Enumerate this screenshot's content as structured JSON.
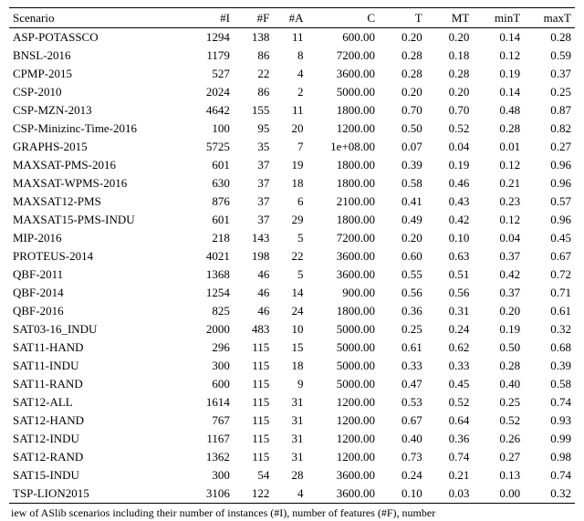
{
  "table": {
    "columns": [
      "Scenario",
      "#I",
      "#F",
      "#A",
      "C",
      "T",
      "MT",
      "minT",
      "maxT"
    ],
    "rows": [
      {
        "scenario": "ASP-POTASSCO",
        "I": "1294",
        "F": "138",
        "A": "11",
        "C": "600.00",
        "T": "0.20",
        "MT": "0.20",
        "minT": "0.14",
        "maxT": "0.28"
      },
      {
        "scenario": "BNSL-2016",
        "I": "1179",
        "F": "86",
        "A": "8",
        "C": "7200.00",
        "T": "0.28",
        "MT": "0.18",
        "minT": "0.12",
        "maxT": "0.59"
      },
      {
        "scenario": "CPMP-2015",
        "I": "527",
        "F": "22",
        "A": "4",
        "C": "3600.00",
        "T": "0.28",
        "MT": "0.28",
        "minT": "0.19",
        "maxT": "0.37"
      },
      {
        "scenario": "CSP-2010",
        "I": "2024",
        "F": "86",
        "A": "2",
        "C": "5000.00",
        "T": "0.20",
        "MT": "0.20",
        "minT": "0.14",
        "maxT": "0.25"
      },
      {
        "scenario": "CSP-MZN-2013",
        "I": "4642",
        "F": "155",
        "A": "11",
        "C": "1800.00",
        "T": "0.70",
        "MT": "0.70",
        "minT": "0.48",
        "maxT": "0.87"
      },
      {
        "scenario": "CSP-Minizinc-Time-2016",
        "I": "100",
        "F": "95",
        "A": "20",
        "C": "1200.00",
        "T": "0.50",
        "MT": "0.52",
        "minT": "0.28",
        "maxT": "0.82"
      },
      {
        "scenario": "GRAPHS-2015",
        "I": "5725",
        "F": "35",
        "A": "7",
        "C": "1e+08.00",
        "T": "0.07",
        "MT": "0.04",
        "minT": "0.01",
        "maxT": "0.27"
      },
      {
        "scenario": "MAXSAT-PMS-2016",
        "I": "601",
        "F": "37",
        "A": "19",
        "C": "1800.00",
        "T": "0.39",
        "MT": "0.19",
        "minT": "0.12",
        "maxT": "0.96"
      },
      {
        "scenario": "MAXSAT-WPMS-2016",
        "I": "630",
        "F": "37",
        "A": "18",
        "C": "1800.00",
        "T": "0.58",
        "MT": "0.46",
        "minT": "0.21",
        "maxT": "0.96"
      },
      {
        "scenario": "MAXSAT12-PMS",
        "I": "876",
        "F": "37",
        "A": "6",
        "C": "2100.00",
        "T": "0.41",
        "MT": "0.43",
        "minT": "0.23",
        "maxT": "0.57"
      },
      {
        "scenario": "MAXSAT15-PMS-INDU",
        "I": "601",
        "F": "37",
        "A": "29",
        "C": "1800.00",
        "T": "0.49",
        "MT": "0.42",
        "minT": "0.12",
        "maxT": "0.96"
      },
      {
        "scenario": "MIP-2016",
        "I": "218",
        "F": "143",
        "A": "5",
        "C": "7200.00",
        "T": "0.20",
        "MT": "0.10",
        "minT": "0.04",
        "maxT": "0.45"
      },
      {
        "scenario": "PROTEUS-2014",
        "I": "4021",
        "F": "198",
        "A": "22",
        "C": "3600.00",
        "T": "0.60",
        "MT": "0.63",
        "minT": "0.37",
        "maxT": "0.67"
      },
      {
        "scenario": "QBF-2011",
        "I": "1368",
        "F": "46",
        "A": "5",
        "C": "3600.00",
        "T": "0.55",
        "MT": "0.51",
        "minT": "0.42",
        "maxT": "0.72"
      },
      {
        "scenario": "QBF-2014",
        "I": "1254",
        "F": "46",
        "A": "14",
        "C": "900.00",
        "T": "0.56",
        "MT": "0.56",
        "minT": "0.37",
        "maxT": "0.71"
      },
      {
        "scenario": "QBF-2016",
        "I": "825",
        "F": "46",
        "A": "24",
        "C": "1800.00",
        "T": "0.36",
        "MT": "0.31",
        "minT": "0.20",
        "maxT": "0.61"
      },
      {
        "scenario": "SAT03-16_INDU",
        "I": "2000",
        "F": "483",
        "A": "10",
        "C": "5000.00",
        "T": "0.25",
        "MT": "0.24",
        "minT": "0.19",
        "maxT": "0.32"
      },
      {
        "scenario": "SAT11-HAND",
        "I": "296",
        "F": "115",
        "A": "15",
        "C": "5000.00",
        "T": "0.61",
        "MT": "0.62",
        "minT": "0.50",
        "maxT": "0.68"
      },
      {
        "scenario": "SAT11-INDU",
        "I": "300",
        "F": "115",
        "A": "18",
        "C": "5000.00",
        "T": "0.33",
        "MT": "0.33",
        "minT": "0.28",
        "maxT": "0.39"
      },
      {
        "scenario": "SAT11-RAND",
        "I": "600",
        "F": "115",
        "A": "9",
        "C": "5000.00",
        "T": "0.47",
        "MT": "0.45",
        "minT": "0.40",
        "maxT": "0.58"
      },
      {
        "scenario": "SAT12-ALL",
        "I": "1614",
        "F": "115",
        "A": "31",
        "C": "1200.00",
        "T": "0.53",
        "MT": "0.52",
        "minT": "0.25",
        "maxT": "0.74"
      },
      {
        "scenario": "SAT12-HAND",
        "I": "767",
        "F": "115",
        "A": "31",
        "C": "1200.00",
        "T": "0.67",
        "MT": "0.64",
        "minT": "0.52",
        "maxT": "0.93"
      },
      {
        "scenario": "SAT12-INDU",
        "I": "1167",
        "F": "115",
        "A": "31",
        "C": "1200.00",
        "T": "0.40",
        "MT": "0.36",
        "minT": "0.26",
        "maxT": "0.99"
      },
      {
        "scenario": "SAT12-RAND",
        "I": "1362",
        "F": "115",
        "A": "31",
        "C": "1200.00",
        "T": "0.73",
        "MT": "0.74",
        "minT": "0.27",
        "maxT": "0.98"
      },
      {
        "scenario": "SAT15-INDU",
        "I": "300",
        "F": "54",
        "A": "28",
        "C": "3600.00",
        "T": "0.24",
        "MT": "0.21",
        "minT": "0.13",
        "maxT": "0.74"
      },
      {
        "scenario": "TSP-LION2015",
        "I": "3106",
        "F": "122",
        "A": "4",
        "C": "3600.00",
        "T": "0.10",
        "MT": "0.03",
        "minT": "0.00",
        "maxT": "0.32"
      }
    ]
  },
  "caption_fragment": "iew of ASlib scenarios including their number of instances (#I), number of features (#F), number"
}
